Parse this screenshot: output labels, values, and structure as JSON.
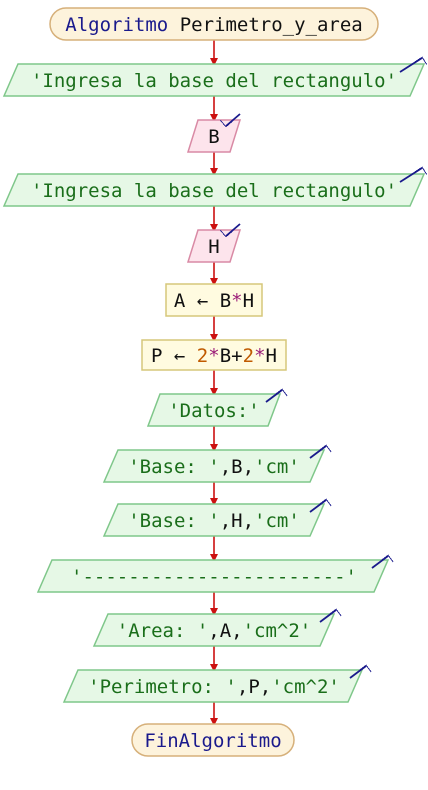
{
  "flowchart": {
    "start": {
      "keyword": "Algoritmo",
      "name": "Perimetro_y_area"
    },
    "read_prompt_base": "'Ingresa la base del rectangulo'",
    "read_var_base": "B",
    "read_prompt_height": "'Ingresa la base del rectangulo'",
    "read_var_height": "H",
    "assign_area": {
      "var": "A",
      "arrow": "←",
      "expr": [
        {
          "t": "B",
          "k": "var"
        },
        {
          "t": "*",
          "k": "op"
        },
        {
          "t": "H",
          "k": "var"
        }
      ]
    },
    "assign_perimeter": {
      "var": "P",
      "arrow": "←",
      "expr": [
        {
          "t": "2",
          "k": "num"
        },
        {
          "t": "*",
          "k": "op"
        },
        {
          "t": "B",
          "k": "var"
        },
        {
          "t": "+",
          "k": "var"
        },
        {
          "t": "2",
          "k": "num"
        },
        {
          "t": "*",
          "k": "op"
        },
        {
          "t": "H",
          "k": "var"
        }
      ]
    },
    "output_datos": "'Datos:'",
    "output_base_1": {
      "parts": [
        "'Base: '",
        ",B,",
        "'cm'"
      ]
    },
    "output_base_2": {
      "parts": [
        "'Base: '",
        ",H,",
        "'cm'"
      ]
    },
    "output_separator": "'-----------------------'",
    "output_area": {
      "parts": [
        "'Area: '",
        ",A,",
        "'cm^2'"
      ]
    },
    "output_perimeter": {
      "parts": [
        "'Perimetro: '",
        ",P,",
        "'cm^2'"
      ]
    },
    "end": "FinAlgoritmo"
  },
  "colors": {
    "terminal_fill": "#fdf3dc",
    "terminal_stroke": "#d6b07a",
    "io_fill": "#e6f8e6",
    "io_stroke": "#7fc78a",
    "read_fill": "#fde4ec",
    "read_stroke": "#d98aa5",
    "process_fill": "#fffbe0",
    "process_stroke": "#d6c77a",
    "arrow": "#cc1111",
    "io_arrow": "#1a1a8c",
    "string_text": "#1a6e1a",
    "keyword_text": "#1a1a8c",
    "number_text": "#c05a00",
    "op_text": "#9b1c78",
    "plain_text": "#111111"
  }
}
